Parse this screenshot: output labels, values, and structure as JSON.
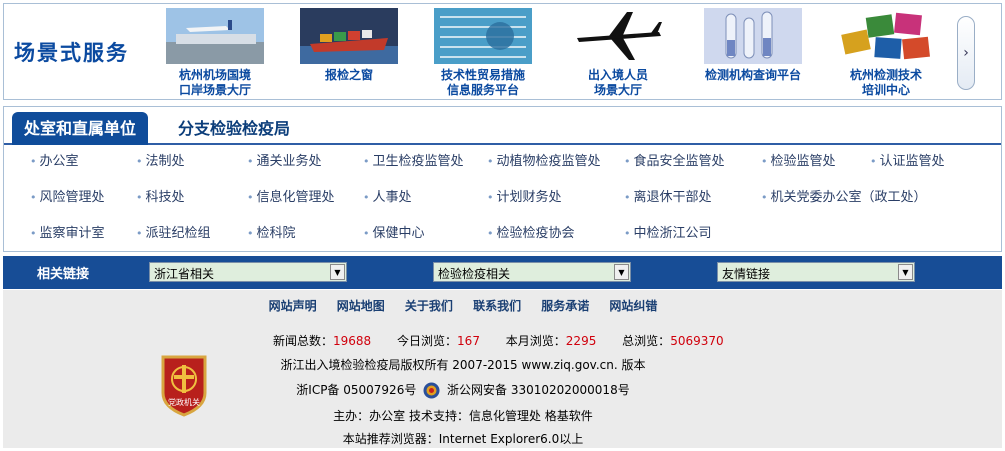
{
  "scene": {
    "title": "场景式服务",
    "items": [
      {
        "line1": "杭州机场国境",
        "line2": "口岸场景大厅"
      },
      {
        "line1": "报检之窗",
        "line2": ""
      },
      {
        "line1": "技术性贸易措施",
        "line2": "信息服务平台"
      },
      {
        "line1": "出入境人员",
        "line2": "场景大厅"
      },
      {
        "line1": "检测机构查询平台",
        "line2": ""
      },
      {
        "line1": "杭州检测技术",
        "line2": "培训中心"
      }
    ],
    "next_icon": "chevron-right-icon"
  },
  "dept": {
    "tabs": [
      {
        "label": "处室和直属单位",
        "active": true
      },
      {
        "label": "分支检验检疫局",
        "active": false
      }
    ],
    "rows": [
      [
        "办公室",
        "法制处",
        "通关业务处",
        "卫生检疫监管处",
        "动植物检疫监管处",
        "食品安全监管处",
        "检验监管处",
        "认证监管处"
      ],
      [
        "风险管理处",
        "科技处",
        "信息化管理处",
        "人事处",
        "计划财务处",
        "离退休干部处",
        "机关党委办公室（政工处）"
      ],
      [
        "监察审计室",
        "派驻纪检组",
        "检科院",
        "保健中心",
        "检验检疫协会",
        "中检浙江公司"
      ]
    ]
  },
  "links": {
    "label": "相关链接",
    "selects": [
      {
        "value": "浙江省相关"
      },
      {
        "value": "检验检疫相关"
      },
      {
        "value": "友情链接"
      }
    ]
  },
  "footer": {
    "nav": [
      "网站声明",
      "网站地图",
      "关于我们",
      "联系我们",
      "服务承诺",
      "网站纠错"
    ],
    "stats": {
      "news_label": "新闻总数：",
      "news": "19688",
      "today_label": "今日浏览：",
      "today": "167",
      "month_label": "本月浏览：",
      "month": "2295",
      "total_label": "总浏览：",
      "total": "5069370"
    },
    "copyright": "浙江出入境检验检疫局版权所有 2007-2015 www.ziq.gov.cn. 版本",
    "icp": "浙ICP备 05007926号",
    "police": "浙公网安备  33010202000018号",
    "host": "主办：办公室 技术支持：信息化管理处 格基软件",
    "browser": "本站推荐浏览器：Internet Explorer6.0以上",
    "emblem_text": "党政机关"
  },
  "colors": {
    "brand_blue": "#0f4c9a",
    "link_bar": "#174d96",
    "stat_red": "#d0000c",
    "footer_bg": "#ebebeb"
  }
}
